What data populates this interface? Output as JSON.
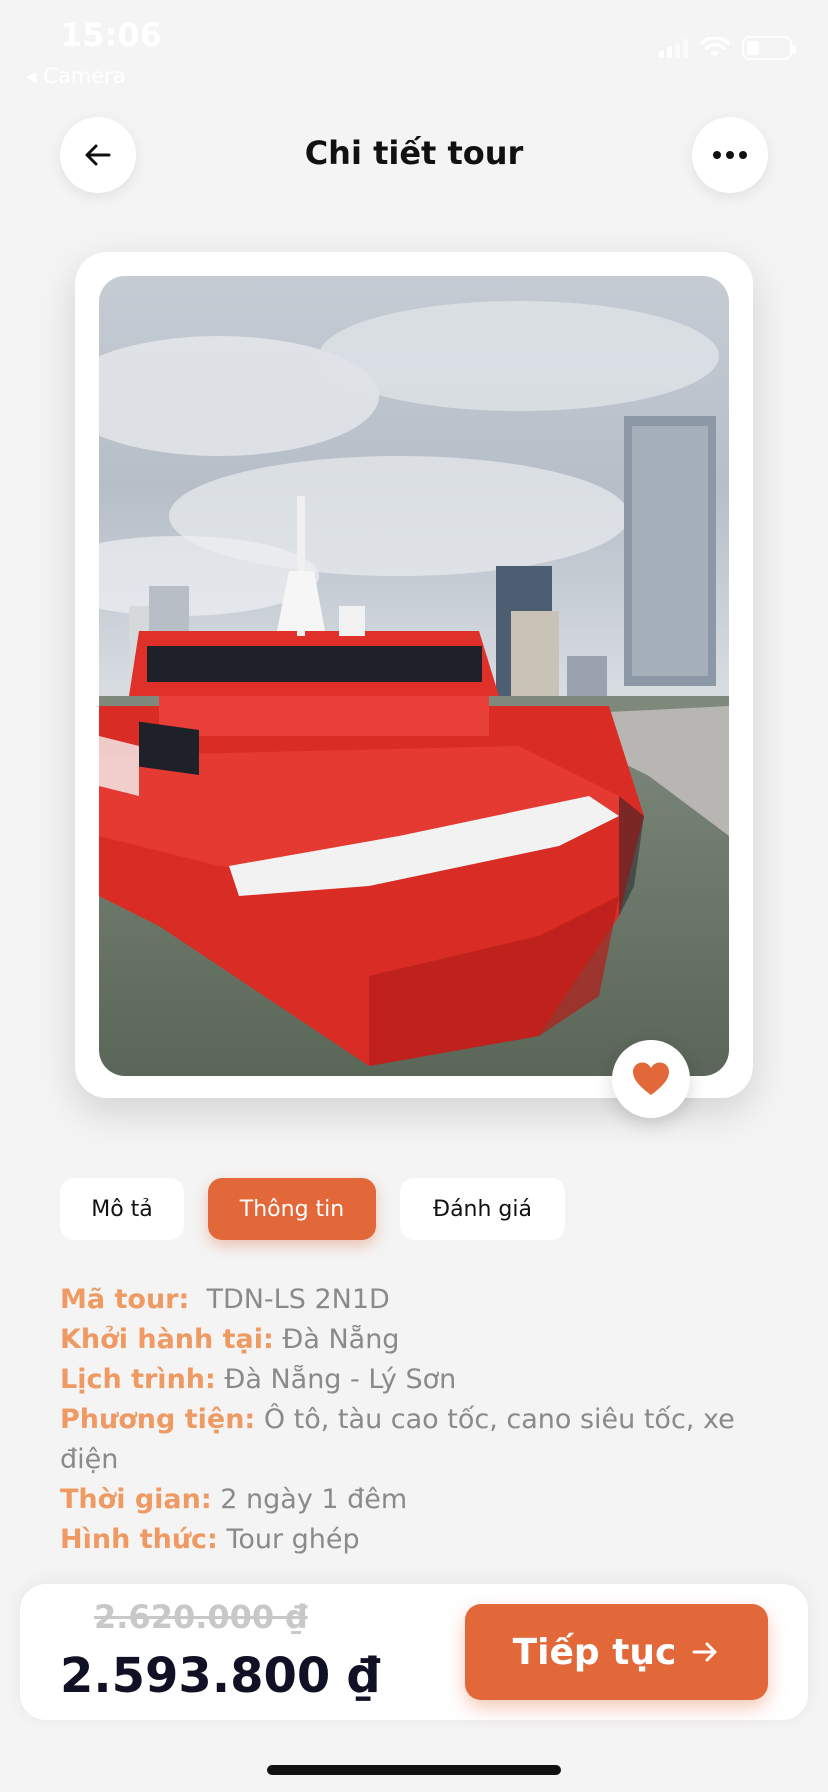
{
  "status_bar": {
    "time": "15:06",
    "back_app": "◂ Camera"
  },
  "header": {
    "title": "Chi tiết tour",
    "back_icon": "arrow-left-icon",
    "more_icon": "more-horizontal-icon"
  },
  "gallery": {
    "favorite_icon": "heart-icon",
    "favorited": true,
    "accent_color": "#e2683a"
  },
  "tabs": [
    {
      "label": "Mô tả",
      "active": false
    },
    {
      "label": "Thông tin",
      "active": true
    },
    {
      "label": "Đánh giá",
      "active": false
    }
  ],
  "info": {
    "tour_code_label": "Mã tour:",
    "tour_code_value": "TDN-LS 2N1D",
    "departure_label": "Khởi hành tại:",
    "departure_value": "Đà Nẵng",
    "itinerary_label": "Lịch trình:",
    "itinerary_value": "Đà Nẵng - Lý Sơn",
    "transport_label": "Phương tiện:",
    "transport_value": "Ô tô, tàu cao tốc, cano siêu tốc, xe điện",
    "duration_label": "Thời gian:",
    "duration_value": "2 ngày 1 đêm",
    "type_label": "Hình thức:",
    "type_value": "Tour ghép"
  },
  "pricing": {
    "old_price": "2.620.000 ₫",
    "new_price": "2.593.800 ₫",
    "continue_label": "Tiếp tục",
    "continue_icon": "arrow-right-icon"
  }
}
